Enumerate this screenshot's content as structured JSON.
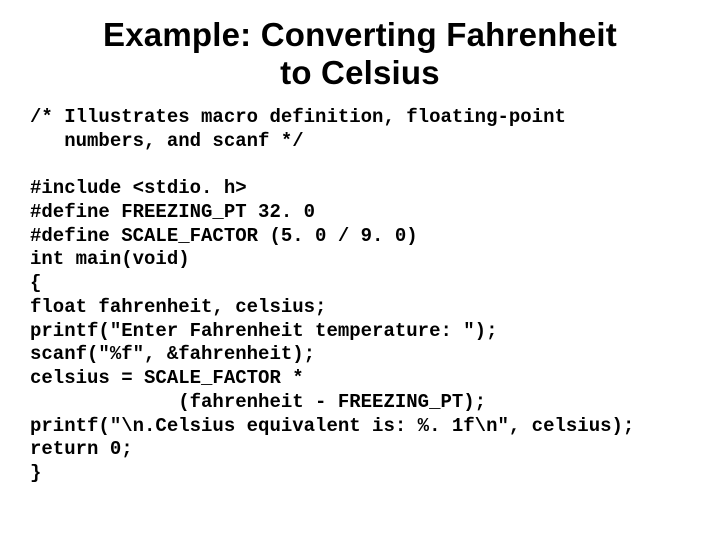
{
  "title_line1": "Example: Converting Fahrenheit",
  "title_line2": "to Celsius",
  "code_lines": [
    "/* Illustrates macro definition, floating-point",
    "   numbers, and scanf */",
    "",
    "#include <stdio. h>",
    "#define FREEZING_PT 32. 0",
    "#define SCALE_FACTOR (5. 0 / 9. 0)",
    "int main(void)",
    "{",
    "float fahrenheit, celsius;",
    "printf(\"Enter Fahrenheit temperature: \");",
    "scanf(\"%f\", &fahrenheit);",
    "celsius = SCALE_FACTOR *",
    "             (fahrenheit - FREEZING_PT);",
    "printf(\"\\n.Celsius equivalent is: %. 1f\\n\", celsius);",
    "return 0;",
    "}"
  ]
}
